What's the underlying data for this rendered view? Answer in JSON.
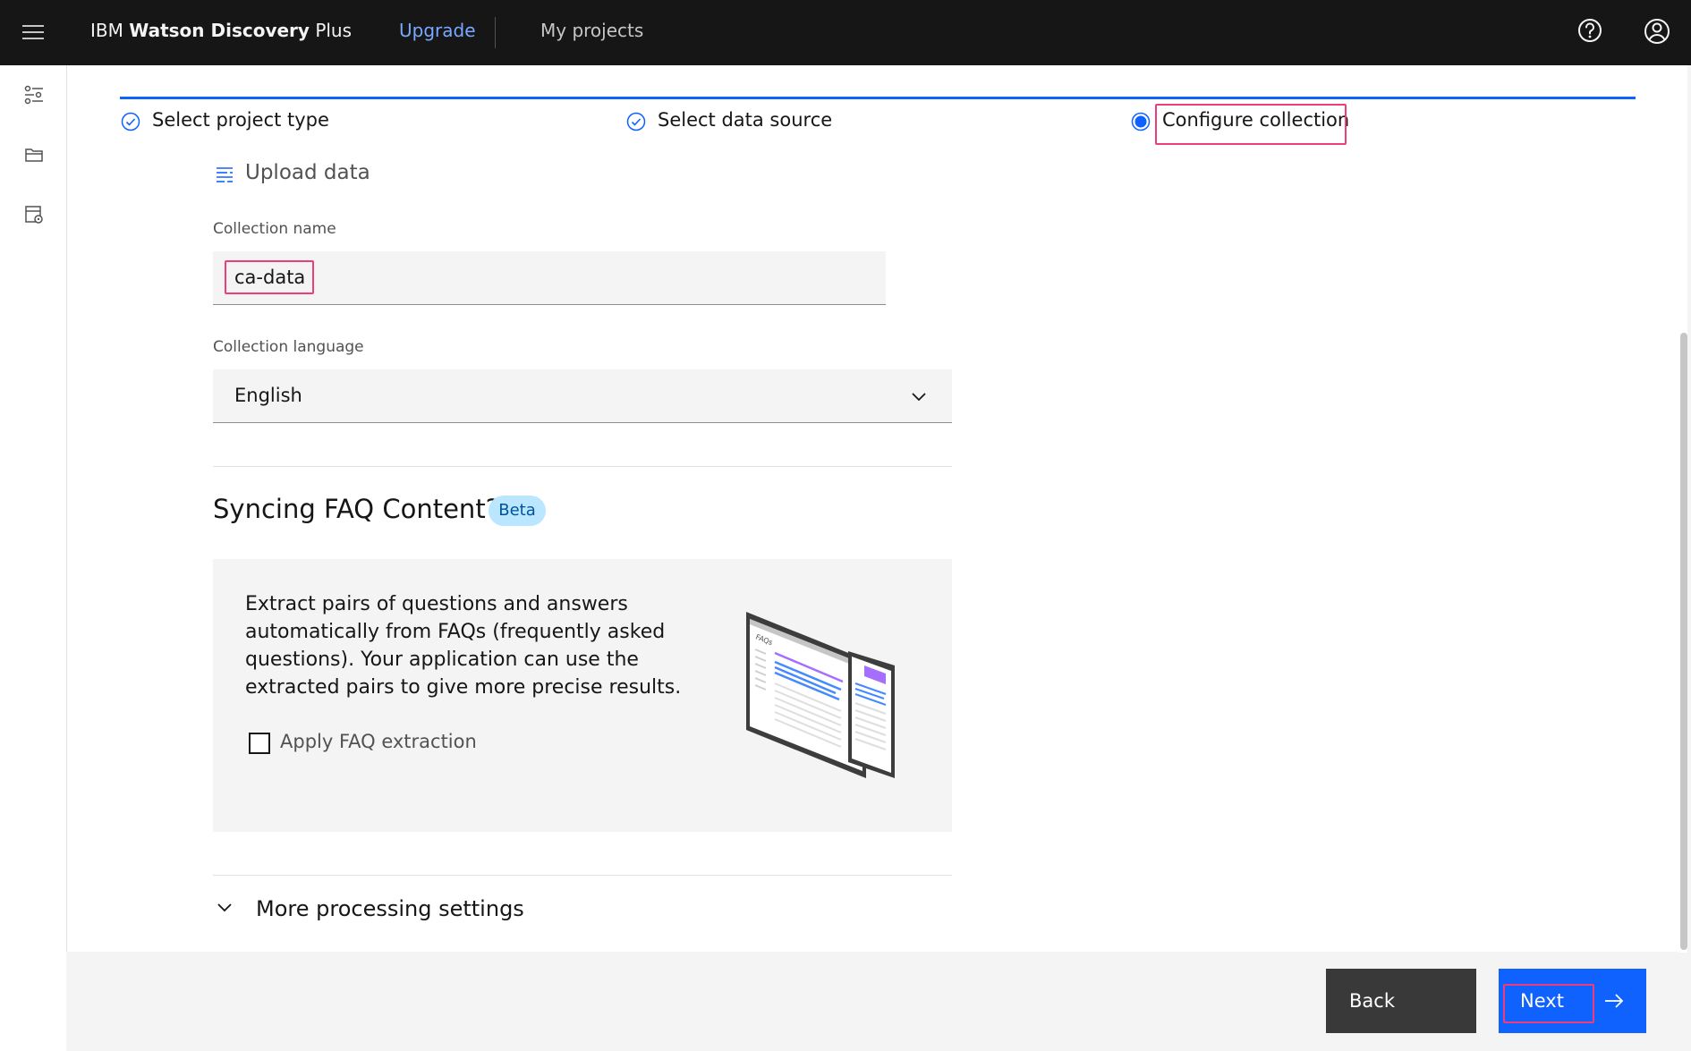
{
  "header": {
    "brand_prefix": "IBM",
    "brand_bold": "Watson Discovery",
    "brand_suffix": "Plus",
    "upgrade": "Upgrade",
    "my_projects": "My projects"
  },
  "progress": {
    "steps": [
      {
        "label": "Select project type",
        "state": "complete"
      },
      {
        "label": "Select data source",
        "state": "complete"
      },
      {
        "label": "Configure collection",
        "state": "current"
      }
    ]
  },
  "section_title": "Upload data",
  "collection_name": {
    "label": "Collection name",
    "value": "ca-data"
  },
  "collection_language": {
    "label": "Collection language",
    "value": "English"
  },
  "faq": {
    "heading": "Syncing FAQ Content?",
    "badge": "Beta",
    "description": "Extract pairs of questions and answers automatically from FAQs (frequently asked questions). Your application can use the extracted pairs to give more precise results.",
    "checkbox_label": "Apply FAQ extraction",
    "checked": false,
    "illustration_text": "FAQs"
  },
  "more_settings": "More processing settings",
  "footer": {
    "back": "Back",
    "next": "Next"
  },
  "colors": {
    "primary": "#0f62fe",
    "header_bg": "#161616",
    "highlight": "#ee3d7c",
    "badge_bg": "#bae6ff"
  }
}
